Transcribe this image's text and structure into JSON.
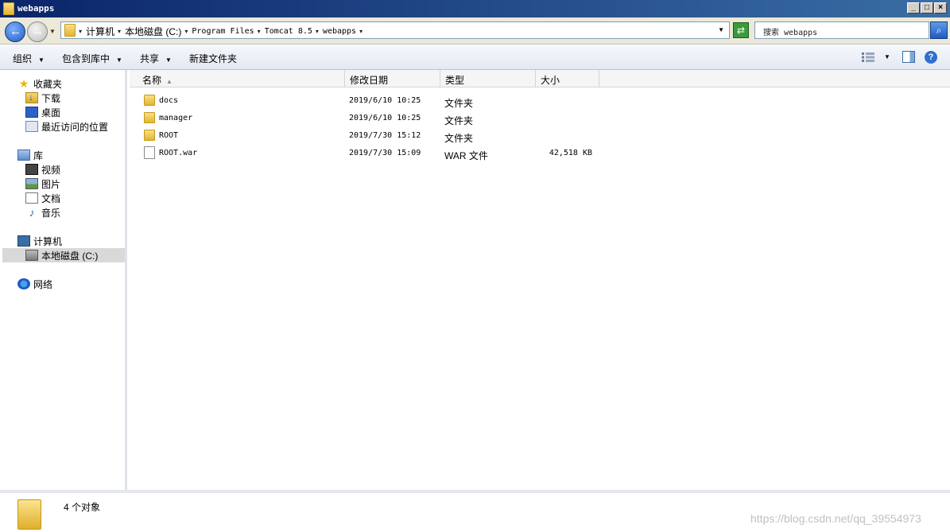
{
  "window": {
    "title": "webapps"
  },
  "address": {
    "crumbs": [
      "计算机",
      "本地磁盘 (C:)",
      "Program Files",
      "Tomcat 8.5",
      "webapps"
    ],
    "search_placeholder": "搜索 webapps"
  },
  "toolbar": {
    "organize": "组织",
    "include_in_library": "包含到库中",
    "share": "共享",
    "new_folder": "新建文件夹"
  },
  "nav": {
    "favorites": "收藏夹",
    "downloads": "下载",
    "desktop": "桌面",
    "recent": "最近访问的位置",
    "libraries": "库",
    "videos": "视频",
    "pictures": "图片",
    "documents": "文档",
    "music": "音乐",
    "computer": "计算机",
    "local_disk": "本地磁盘 (C:)",
    "network": "网络"
  },
  "columns": {
    "name": "名称",
    "modified": "修改日期",
    "type": "类型",
    "size": "大小"
  },
  "files": [
    {
      "name": "docs",
      "modified": "2019/6/10 10:25",
      "type": "文件夹",
      "size": "",
      "icon": "folder-icon"
    },
    {
      "name": "manager",
      "modified": "2019/6/10 10:25",
      "type": "文件夹",
      "size": "",
      "icon": "folder-icon"
    },
    {
      "name": "ROOT",
      "modified": "2019/7/30 15:12",
      "type": "文件夹",
      "size": "",
      "icon": "folder-icon"
    },
    {
      "name": "ROOT.war",
      "modified": "2019/7/30 15:09",
      "type": "WAR 文件",
      "size": "42,518 KB",
      "icon": "file-icon"
    }
  ],
  "details": {
    "count": "4 个对象"
  },
  "watermark": "https://blog.csdn.net/qq_39554973",
  "colors": {
    "titlebar": "#0a246a",
    "accent": "#1d5bc3"
  }
}
